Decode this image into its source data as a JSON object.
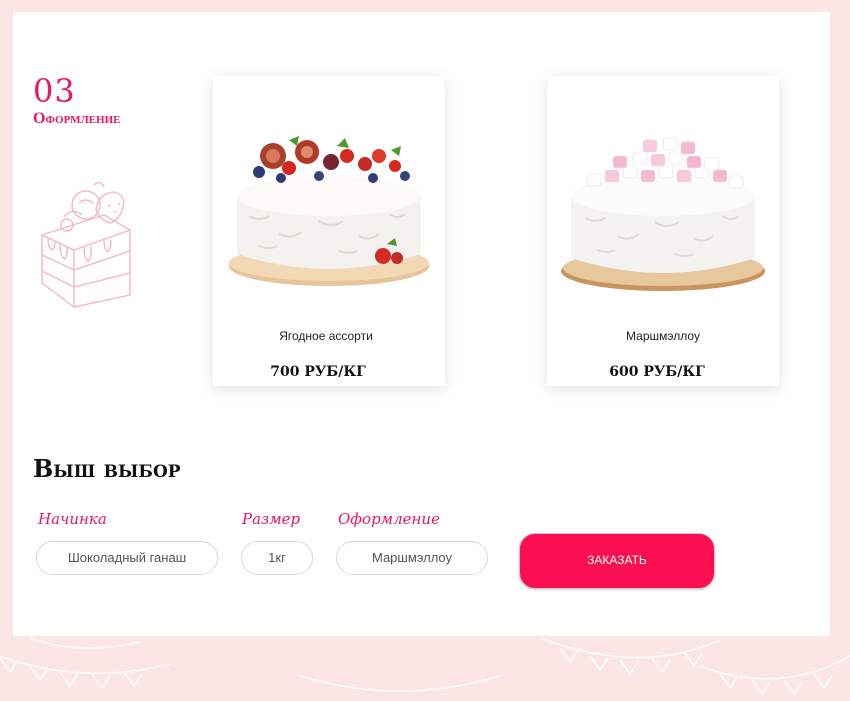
{
  "section": {
    "number": "03",
    "title": "Оформление"
  },
  "cards": [
    {
      "name": "Ягодное ассорти",
      "price": "700 РУБ/КГ",
      "image": "berry-cake-image"
    },
    {
      "name": "Маршмэллоу",
      "price": "600 РУБ/КГ",
      "image": "marshmallow-cake-image"
    }
  ],
  "choice": {
    "title": "Выш выбор",
    "filling_label": "Начинка",
    "filling_value": "Шоколадный ганаш",
    "size_label": "Размер",
    "size_value": "1кг",
    "decor_label": "Оформление",
    "decor_value": "Маршмэллоу",
    "order_button": "ЗАКАЗАТЬ"
  },
  "colors": {
    "accent": "#e8195a",
    "button": "#fc0f52",
    "background": "#fbe5e5"
  }
}
